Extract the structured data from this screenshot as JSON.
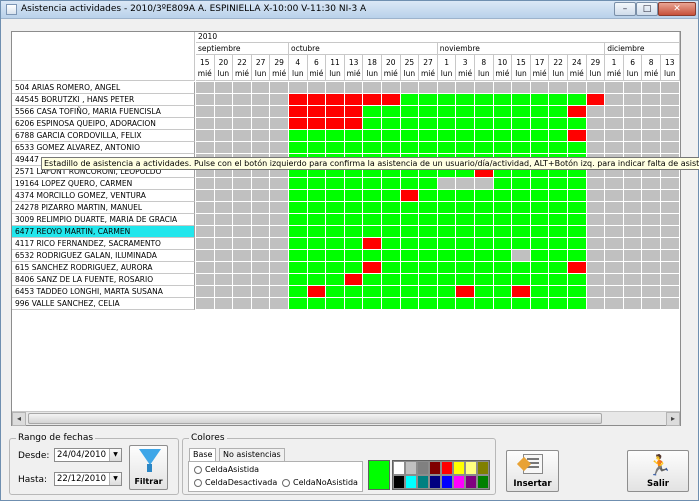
{
  "window": {
    "title": "Asistencia actividades - 2010/3ºE809A A. ESPINIELLA X-10:00 V-11:30 NI-3 A",
    "min_label": "–",
    "max_label": "□",
    "close_label": "✕"
  },
  "grid": {
    "year": "2010",
    "months": [
      {
        "label": "septiembre",
        "span": 5
      },
      {
        "label": "octubre",
        "span": 8
      },
      {
        "label": "noviembre",
        "span": 9
      },
      {
        "label": "diciembre",
        "span": 4
      }
    ],
    "days": [
      {
        "num": "15",
        "dow": "mié"
      },
      {
        "num": "20",
        "dow": "lun"
      },
      {
        "num": "22",
        "dow": "mié"
      },
      {
        "num": "27",
        "dow": "lun"
      },
      {
        "num": "29",
        "dow": "mié"
      },
      {
        "num": "4",
        "dow": "lun"
      },
      {
        "num": "6",
        "dow": "mié"
      },
      {
        "num": "11",
        "dow": "lun"
      },
      {
        "num": "13",
        "dow": "mié"
      },
      {
        "num": "18",
        "dow": "lun"
      },
      {
        "num": "20",
        "dow": "mié"
      },
      {
        "num": "25",
        "dow": "lun"
      },
      {
        "num": "27",
        "dow": "mié"
      },
      {
        "num": "1",
        "dow": "lun"
      },
      {
        "num": "3",
        "dow": "mié"
      },
      {
        "num": "8",
        "dow": "lun"
      },
      {
        "num": "10",
        "dow": "mié"
      },
      {
        "num": "15",
        "dow": "lun"
      },
      {
        "num": "17",
        "dow": "mié"
      },
      {
        "num": "22",
        "dow": "lun"
      },
      {
        "num": "24",
        "dow": "mié"
      },
      {
        "num": "29",
        "dow": "lun"
      },
      {
        "num": "1",
        "dow": "mié"
      },
      {
        "num": "6",
        "dow": "lun"
      },
      {
        "num": "8",
        "dow": "mié"
      },
      {
        "num": "13",
        "dow": "lun"
      }
    ],
    "selected_row": 12,
    "rows": [
      {
        "name": "504 ARIAS ROMERO, ANGEL",
        "cells": "gggggggggggggggggggggggggg"
      },
      {
        "name": "44545 BORUTZKI , HANS PETER",
        "cells": "gggggRRRRRRGGGGGGGGGGRgggg"
      },
      {
        "name": "5566 CASA TOFIÑO, MARIA FUENCISLA",
        "cells": "gggggRRRRGGGGGGGGGGGRggggg"
      },
      {
        "name": "6206 ESPINOSA QUEIPO, ADORACION",
        "cells": "gggggRRRRGGGGGGGGGGGGggggg"
      },
      {
        "name": "6788 GARCIA CORDOVILLA, FELIX",
        "cells": "gggggGGGGGGGGGGGGGGGRggggg"
      },
      {
        "name": "6533 GOMEZ ALVAREZ, ANTONIO",
        "cells": "gggggGGGGGGGGGGGGGGGGggggg"
      },
      {
        "name": "49447",
        "cells": "gggggGGGGGGGGGGGGGGGGggggg"
      },
      {
        "name": "2571 LAFONT RONCORONI, LEOPOLDO",
        "cells": "gggggGGGGGGGGGGRGGGGGggggg"
      },
      {
        "name": "19164 LOPEZ QUERO, CARMEN",
        "cells": "gggggGGGGGGGGgggGGGGGggggg"
      },
      {
        "name": "4374 MORCILLO GOMEZ, VENTURA",
        "cells": "gggggGGGGGGRGGGGGGGGGggggg"
      },
      {
        "name": "24278 PIZARRO MARTIN, MANUEL",
        "cells": "gggggGGGGGGGGGGGGGGGGggggg"
      },
      {
        "name": "3009 RELIMPIO DUARTE, MARIA DE GRACIA",
        "cells": "gggggGGGGGGGGGGGGGGGGggggg"
      },
      {
        "name": "6477 REOYO MARTIN, CARMEN",
        "cells": "gggggGGGGGGGGGGGGGGGGggggg"
      },
      {
        "name": "4117 RICO FERNANDEZ, SACRAMENTO",
        "cells": "gggggGGGGRGGGGGGGGGGGggggg"
      },
      {
        "name": "6532 RODRIGUEZ GALAN, ILUMINADA",
        "cells": "gggggGGGGGGGGGGGGgGGGggggg"
      },
      {
        "name": "615 SANCHEZ RODRIGUEZ, AURORA",
        "cells": "gggggGGGGRGGGGGGGGGGRggggg"
      },
      {
        "name": "8406 SANZ DE LA FUENTE, ROSARIO",
        "cells": "gggggGGGRGGGGGGGGGGGGggggg"
      },
      {
        "name": "6453 TADDEO LONGHI, MARTA SUSANA",
        "cells": "gggggGRGGGGGGGRGGRGGGggggg"
      },
      {
        "name": "996 VALLE SANCHEZ, CELIA",
        "cells": "gggggGGGGGGGGGGGGGGGGggggg"
      }
    ]
  },
  "tooltip": "Estadillo de asistencia a actividades. Pulse con el botón izquierdo para confirma la asistencia de un usuario/día/actividad, ALT+Botón izq. para indicar falta de asistencia",
  "scroll": {
    "left_arrow": "◂",
    "right_arrow": "▸"
  },
  "rango": {
    "legend": "Rango de fechas",
    "desde_label": "Desde:",
    "desde_value": "24/04/2010",
    "hasta_label": "Hasta:",
    "hasta_value": "22/12/2010",
    "dd_arrow": "▼",
    "filtrar_label": "Filtrar"
  },
  "colores": {
    "legend": "Colores",
    "tabs": [
      "Base",
      "No asistencias"
    ],
    "radios": [
      "CeldaAsistida",
      "CeldaDesactivada",
      "CeldaNoAsistida"
    ],
    "preview_color": "#00ff00",
    "palette": [
      "#ffffff",
      "#c0c0c0",
      "#808080",
      "#800000",
      "#ff0000",
      "#ffff00",
      "#ffff80",
      "#808000",
      "#000000",
      "#00ffff",
      "#008080",
      "#000080",
      "#0000ff",
      "#ff00ff",
      "#800080",
      "#008000"
    ]
  },
  "buttons": {
    "insertar": "Insertar",
    "salir": "Salir"
  },
  "colors": {
    "attended": "#00ff00",
    "absent": "#ff0000",
    "inactive": "#c0c0c0",
    "selected_row": "#22e6ec"
  }
}
